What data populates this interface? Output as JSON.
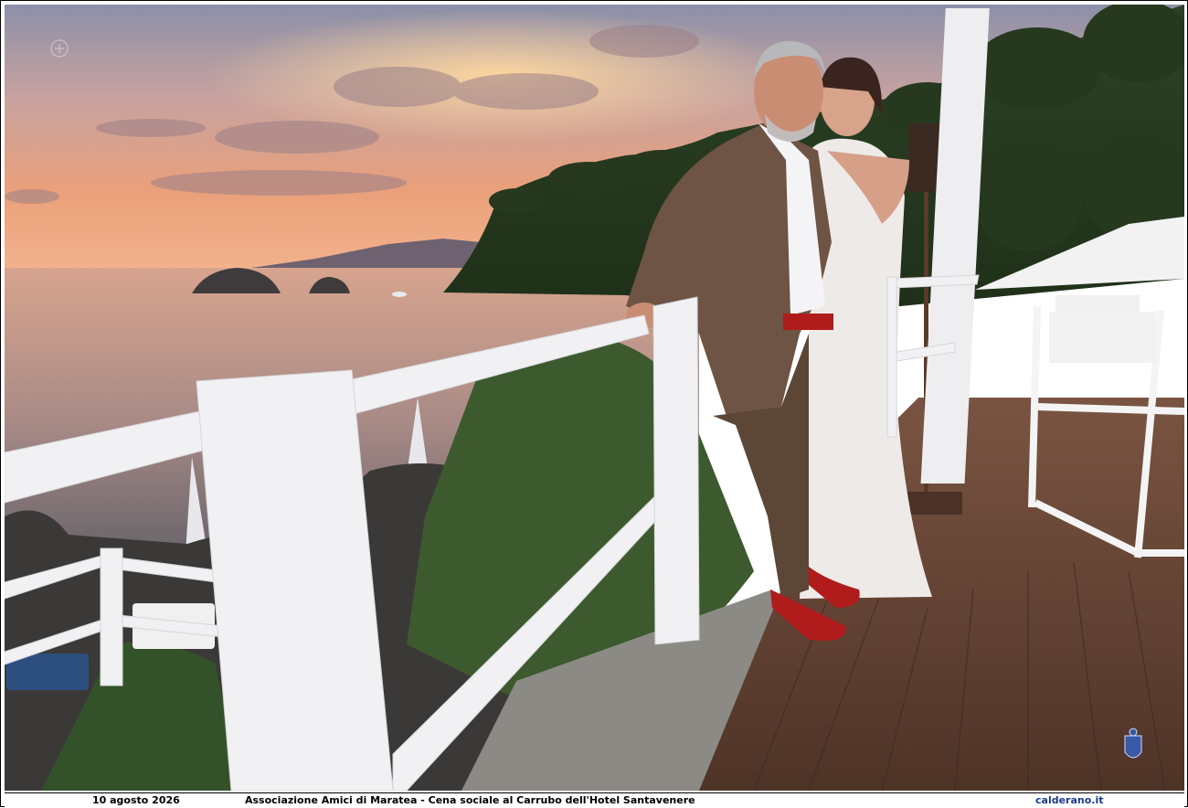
{
  "caption": {
    "date": "10 agosto 2026",
    "event": "Associazione Amici di Maratea - Cena sociale al Carrubo dell'Hotel Santavenere",
    "site": "calderano.it"
  },
  "colors": {
    "sky_top": "#8a8da5",
    "sky_glow": "#f0a070",
    "sea": "#c89a86",
    "deck": "#6b4a3a",
    "railing": "#f2f2f2",
    "foliage": "#2f4a25",
    "caption_site": "#1a3a8a"
  }
}
